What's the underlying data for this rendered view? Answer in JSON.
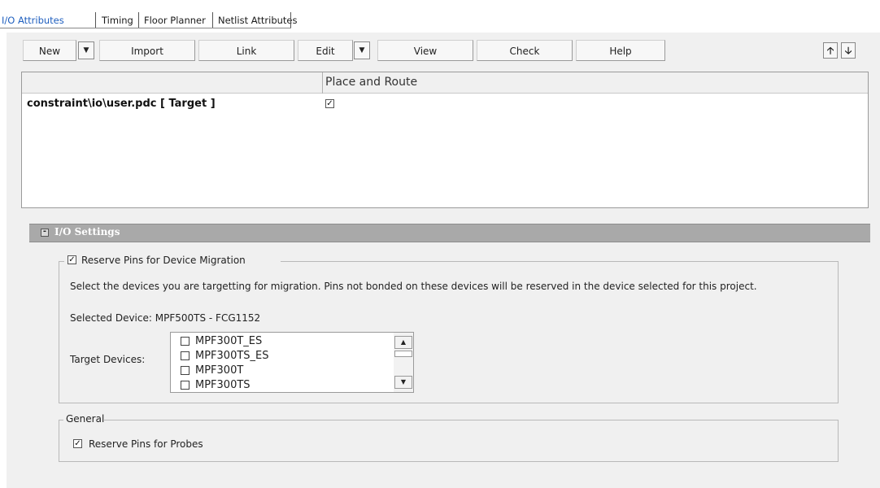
{
  "tabs": [
    {
      "label": "I/O Attributes",
      "active": true
    },
    {
      "label": "Timing",
      "active": false
    },
    {
      "label": "Floor Planner",
      "active": false
    },
    {
      "label": "Netlist Attributes",
      "active": false
    }
  ],
  "toolbar": {
    "new_label": "New",
    "import_label": "Import",
    "link_label": "Link",
    "edit_label": "Edit",
    "view_label": "View",
    "check_label": "Check",
    "help_label": "Help",
    "move_up_icon": "arrow-up-icon",
    "move_down_icon": "arrow-down-icon"
  },
  "constraints_table": {
    "columns": [
      "",
      "Place and Route"
    ],
    "rows": [
      {
        "file": "constraint\\io\\user.pdc  [ Target ]",
        "place_and_route": true
      }
    ]
  },
  "io_settings": {
    "title": "I/O Settings",
    "migration_group": {
      "label": "Reserve Pins for Device Migration",
      "checked": true,
      "description": "Select the devices you are targetting for migration. Pins not bonded on these devices will be reserved in the device selected for this project.",
      "selected_device_label": "Selected Device:",
      "selected_device_value": "MPF500TS - FCG1152",
      "target_devices_label": "Target Devices:",
      "target_devices": [
        {
          "name": "MPF300T_ES",
          "checked": false
        },
        {
          "name": "MPF300TS_ES",
          "checked": false
        },
        {
          "name": "MPF300T",
          "checked": false
        },
        {
          "name": "MPF300TS",
          "checked": false
        }
      ]
    },
    "general_group": {
      "legend": "General",
      "reserve_probes_label": "Reserve Pins for Probes",
      "reserve_probes_checked": true
    }
  },
  "colors": {
    "active_tab": "#1f5fbf",
    "section_header": "#a9a9a9",
    "panel_bg": "#f0f0f0"
  }
}
